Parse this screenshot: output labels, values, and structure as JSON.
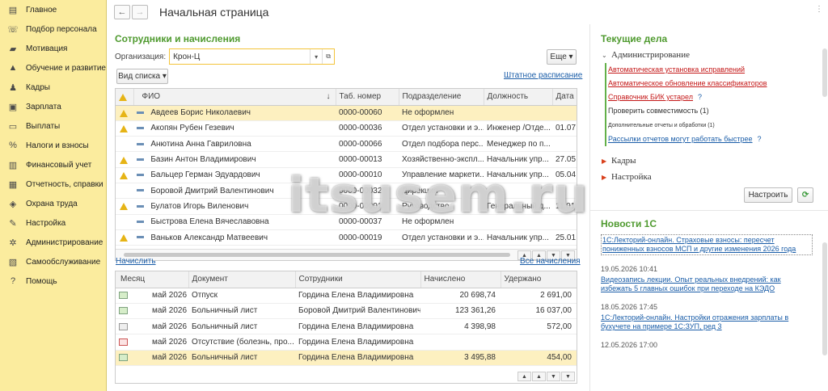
{
  "sidebar": {
    "items": [
      {
        "label": "Главное",
        "icon": "home-icon",
        "glyph": "▤"
      },
      {
        "label": "Подбор персонала",
        "icon": "phone-icon",
        "glyph": "☏"
      },
      {
        "label": "Мотивация",
        "icon": "briefcase-icon",
        "glyph": "▰"
      },
      {
        "label": "Обучение и развитие",
        "icon": "graduation-icon",
        "glyph": "▲"
      },
      {
        "label": "Кадры",
        "icon": "people-icon",
        "glyph": "♟"
      },
      {
        "label": "Зарплата",
        "icon": "wallet-icon",
        "glyph": "▣"
      },
      {
        "label": "Выплаты",
        "icon": "card-icon",
        "glyph": "▭"
      },
      {
        "label": "Налоги и взносы",
        "icon": "percent-icon",
        "glyph": "%"
      },
      {
        "label": "Финансовый учет",
        "icon": "ledger-icon",
        "glyph": "▥"
      },
      {
        "label": "Отчетность, справки",
        "icon": "report-icon",
        "glyph": "▦"
      },
      {
        "label": "Охрана труда",
        "icon": "shield-icon",
        "glyph": "◈"
      },
      {
        "label": "Настройка",
        "icon": "wrench-icon",
        "glyph": "✎"
      },
      {
        "label": "Администрирование",
        "icon": "gear-icon",
        "glyph": "✲"
      },
      {
        "label": "Самообслуживание",
        "icon": "selfservice-icon",
        "glyph": "▧"
      },
      {
        "label": "Помощь",
        "icon": "help-icon",
        "glyph": "?"
      }
    ]
  },
  "header": {
    "back": "←",
    "forward": "→",
    "title": "Начальная страница"
  },
  "employees": {
    "title": "Сотрудники и начисления",
    "org_label": "Организация:",
    "org_value": "Крон-Ц",
    "more_button": "Еще",
    "view_list_button": "Вид списка",
    "staff_link": "Штатное расписание",
    "columns": [
      "ФИО",
      "Таб. номер",
      "Подразделение",
      "Должность",
      "Дата"
    ],
    "rows": [
      {
        "warn": true,
        "name": "Авдеев Борис Николаевич",
        "tab": "0000-00060",
        "dept": "Не оформлен",
        "dept_red": true,
        "pos": "",
        "date": ""
      },
      {
        "warn": true,
        "name": "Акопян Рубен Гезевич",
        "tab": "0000-00036",
        "dept": "Отдел установки и э...",
        "dept_red": false,
        "pos": "Инженер /Отде...",
        "date": "01.07"
      },
      {
        "warn": false,
        "name": "Анютина Анна Гавриловна",
        "tab": "0000-00066",
        "dept": "Отдел подбора перс...",
        "dept_red": false,
        "pos": "Менеджер по п...",
        "date": ""
      },
      {
        "warn": true,
        "name": "Базин Антон Владимирович",
        "tab": "0000-00013",
        "dept": "Хозяйственно-экспл...",
        "dept_red": false,
        "pos": "Начальник упр...",
        "date": "27.05"
      },
      {
        "warn": true,
        "name": "Бальцер Герман Эдуардович",
        "tab": "0000-00010",
        "dept": "Управление маркети...",
        "dept_red": false,
        "pos": "Начальник упр...",
        "date": "05.04"
      },
      {
        "warn": false,
        "name": "Боровой Дмитрий Валентинович",
        "tab": "0000-00032",
        "dept": "Дирекция",
        "dept_red": false,
        "pos": "",
        "date": ""
      },
      {
        "warn": true,
        "name": "Булатов Игорь Виленович",
        "tab": "0000-00001",
        "dept": "Руководство",
        "dept_red": false,
        "pos": "Генеральный д...",
        "date": "11.01"
      },
      {
        "warn": false,
        "name": "Быстрова Елена Вячеславовна",
        "tab": "0000-00037",
        "dept": "Не оформлен",
        "dept_red": true,
        "pos": "",
        "date": ""
      },
      {
        "warn": true,
        "name": "Ваньков Александр Матвеевич",
        "tab": "0000-00019",
        "dept": "Отдел установки и э...",
        "dept_red": false,
        "pos": "Начальник упр...",
        "date": "25.01"
      }
    ]
  },
  "accruals": {
    "accrue_link": "Начислить",
    "all_link": "Все начисления",
    "columns": [
      "Месяц",
      "Документ",
      "Сотрудники",
      "Начислено",
      "Удержано"
    ],
    "rows": [
      {
        "icon": "g",
        "month": "май 2026",
        "doc": "Отпуск",
        "emp": "Гордина Елена Владимировна",
        "acc": "20 698,74",
        "ded": "2 691,00"
      },
      {
        "icon": "g",
        "month": "май 2026",
        "doc": "Больничный лист",
        "emp": "Боровой Дмитрий Валентинович",
        "acc": "123 361,26",
        "ded": "16 037,00"
      },
      {
        "icon": "p",
        "month": "май 2026",
        "doc": "Больничный лист",
        "emp": "Гордина Елена Владимировна",
        "acc": "4 398,98",
        "ded": "572,00"
      },
      {
        "icon": "x",
        "month": "май 2026",
        "doc": "Отсутствие (болезнь, про...",
        "emp": "Гордина Елена Владимировна",
        "acc": "",
        "ded": ""
      },
      {
        "icon": "g",
        "month": "май 2026",
        "doc": "Больничный лист",
        "emp": "Гордина Елена Владимировна",
        "acc": "3 495,88",
        "ded": "454,00"
      }
    ]
  },
  "todo": {
    "title": "Текущие дела",
    "groups": [
      {
        "label": "Администрирование",
        "open": true
      },
      {
        "label": "Кадры",
        "open": false
      },
      {
        "label": "Настройка",
        "open": false
      }
    ],
    "items": [
      {
        "text": "Автоматическая установка исправлений",
        "style": "red"
      },
      {
        "text": "Автоматическое обновление классификаторов",
        "style": "red"
      },
      {
        "text": "Справочник БИК устарел",
        "style": "red",
        "q": "?"
      },
      {
        "text": "Проверить совместимость (1)",
        "style": "plain"
      },
      {
        "text": "Дополнительные отчеты и обработки (1)",
        "style": "small"
      },
      {
        "text": "Рассылки отчетов могут работать быстрее",
        "style": "blue",
        "q": "?"
      }
    ],
    "configure_button": "Настроить",
    "refresh_icon": "⟳"
  },
  "news": {
    "title": "Новости 1С",
    "items": [
      {
        "date": "",
        "text": "1С:Лекторий-онлайн. Страховые взносы: пересчет пониженных взносов МСП и другие изменения 2026 года"
      },
      {
        "date": "19.05.2026 10:41",
        "text": "Видеозапись лекции. Опыт реальных внедрений: как избежать 5 главных ошибок при переходе на КЭДО"
      },
      {
        "date": "18.05.2026 17:45",
        "text": "1С:Лекторий-онлайн. Настройки отражения зарплаты в бухучете на примере 1С:ЗУП, ред 3"
      },
      {
        "date": "12.05.2026 17:00",
        "text": ""
      }
    ]
  },
  "watermark": "itsusem.ru"
}
